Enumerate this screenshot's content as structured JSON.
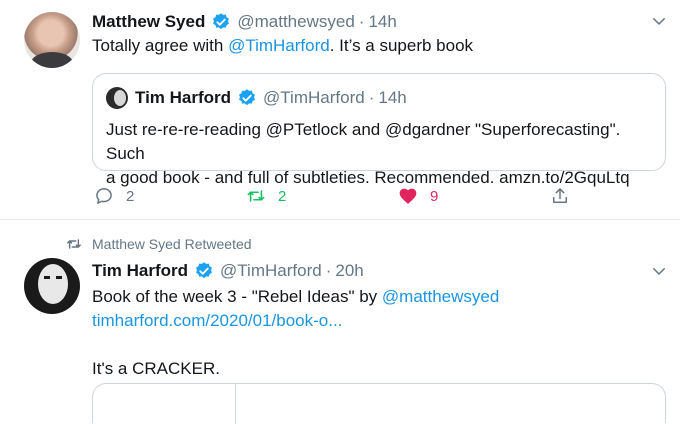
{
  "tweet1": {
    "name": "Matthew Syed",
    "handle": "@matthewsyed",
    "separator": "·",
    "time": "14h",
    "text_before": "Totally agree with ",
    "mention": "@TimHarford",
    "text_after": ". It’s a superb book"
  },
  "quote": {
    "name": "Tim Harford",
    "handle": "@TimHarford",
    "separator": "·",
    "time": "14h",
    "line1": "Just re-re-re-reading @PTetlock and @dgardner \"Superforecasting\". Such",
    "line2": "a good book - and full of subtleties. Recommended. amzn.to/2GquLtq"
  },
  "actions": {
    "reply_count": "2",
    "retweet_count": "2",
    "like_count": "9"
  },
  "retweet_label": "Matthew Syed Retweeted",
  "tweet2": {
    "name": "Tim Harford",
    "handle": "@TimHarford",
    "separator": "·",
    "time": "20h",
    "line1_before": "Book of the week 3 - \"Rebel Ideas\" by ",
    "line1_mention": "@matthewsyed",
    "line2_link": "timharford.com/2020/01/book-o...",
    "line4": "It's a CRACKER."
  },
  "colors": {
    "link": "#1b95e0",
    "retweet": "#17bf63",
    "like": "#e0245e",
    "muted": "#657786",
    "verified": "#1da1f2"
  },
  "icons": [
    "verified-badge-icon",
    "chevron-down-icon",
    "reply-icon",
    "retweet-icon",
    "like-icon",
    "share-icon"
  ]
}
